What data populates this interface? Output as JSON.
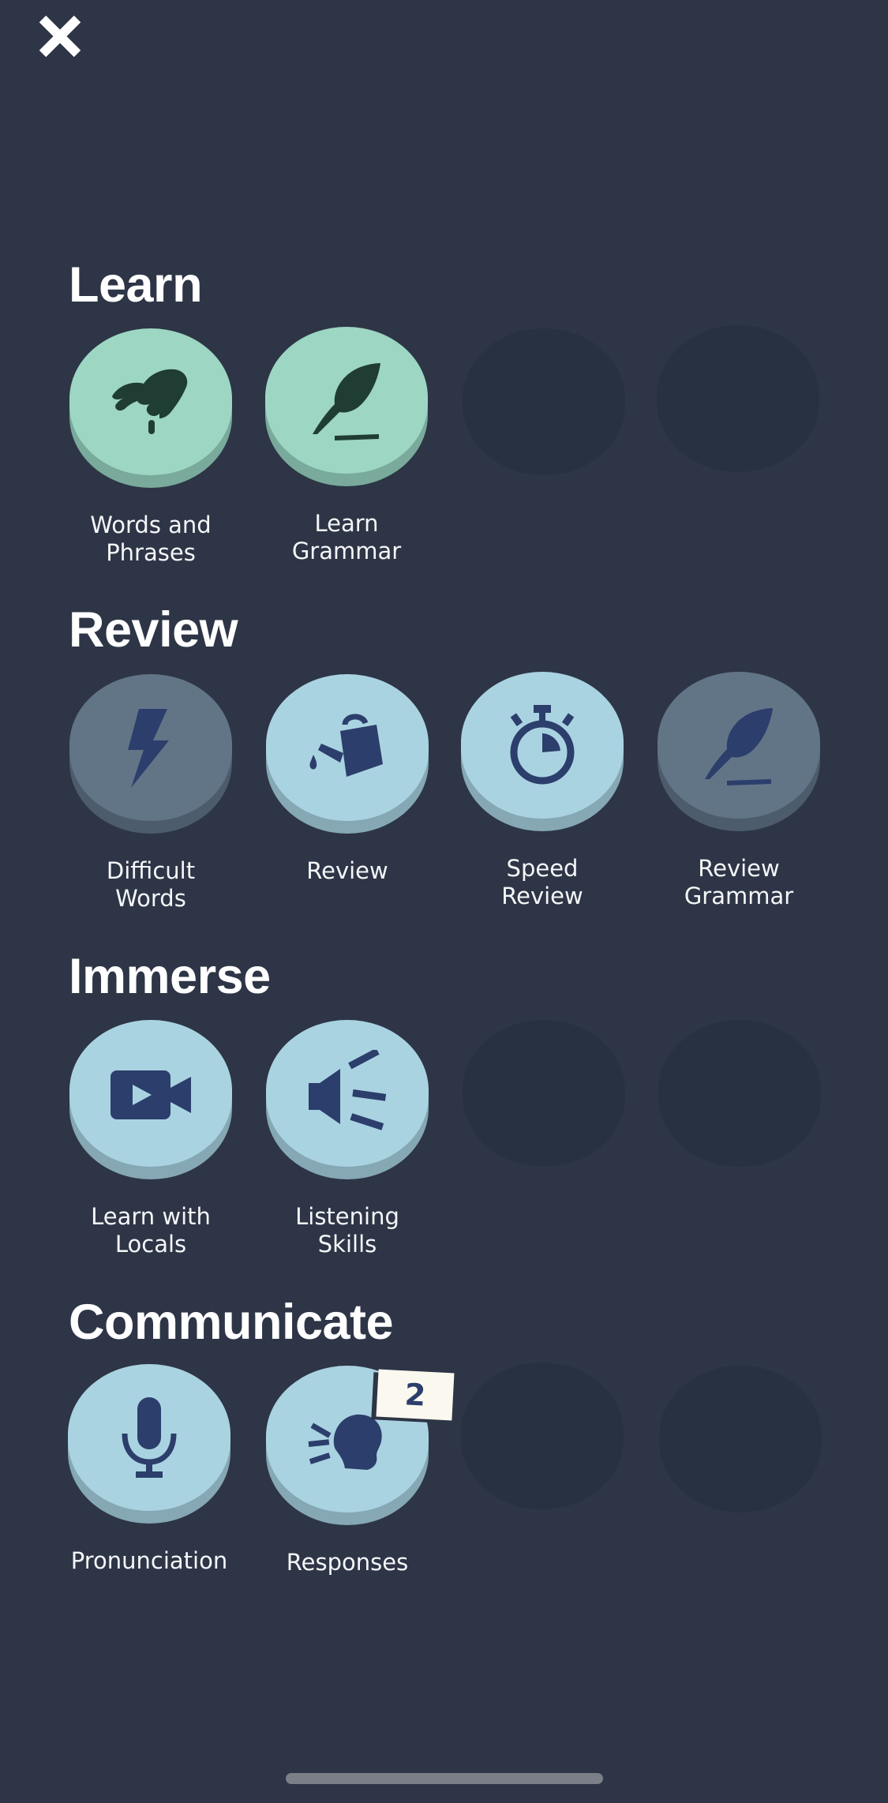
{
  "close_label": "Close",
  "colors": {
    "background": "#2d3546",
    "learn_green": "#9dd6c2",
    "review_blue": "#aad3e2",
    "locked_gray": "#627587",
    "icon_navy": "#2c3e6b",
    "icon_dark_green": "#203d33"
  },
  "sections": {
    "learn": {
      "title": "Learn",
      "tiles": [
        {
          "label": "Words and\nPhrases",
          "icon": "pinch-hand-icon",
          "state": "active"
        },
        {
          "label": "Learn\nGrammar",
          "icon": "quill-icon",
          "state": "active"
        }
      ]
    },
    "review": {
      "title": "Review",
      "tiles": [
        {
          "label": "Difficult\nWords",
          "icon": "lightning-icon",
          "state": "locked"
        },
        {
          "label": "Review",
          "icon": "watering-can-icon",
          "state": "active"
        },
        {
          "label": "Speed\nReview",
          "icon": "stopwatch-icon",
          "state": "active"
        },
        {
          "label": "Review\nGrammar",
          "icon": "quill-icon",
          "state": "locked"
        }
      ]
    },
    "immerse": {
      "title": "Immerse",
      "tiles": [
        {
          "label": "Learn with\nLocals",
          "icon": "video-camera-icon",
          "state": "active"
        },
        {
          "label": "Listening\nSkills",
          "icon": "speaker-icon",
          "state": "active"
        }
      ]
    },
    "communicate": {
      "title": "Communicate",
      "tiles": [
        {
          "label": "Pronunciation",
          "icon": "microphone-icon",
          "state": "active"
        },
        {
          "label": "Responses",
          "icon": "speaking-head-icon",
          "state": "active",
          "badge": "2"
        }
      ]
    }
  }
}
